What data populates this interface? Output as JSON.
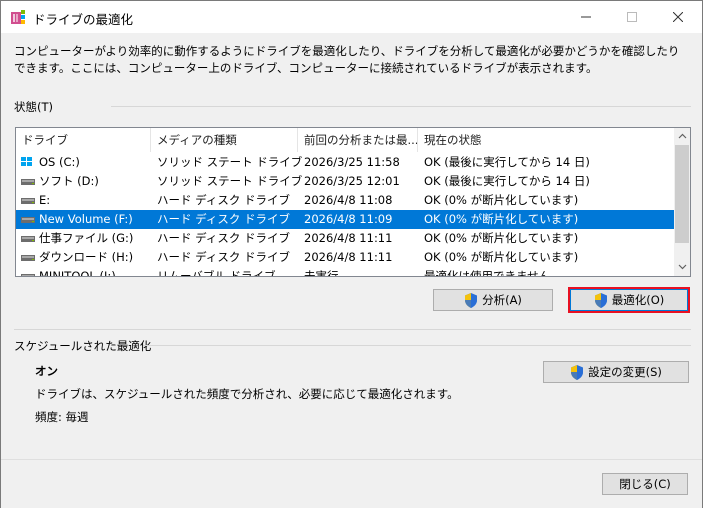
{
  "window": {
    "title": "ドライブの最適化"
  },
  "description": "コンピューターがより効率的に動作するようにドライブを最適化したり、ドライブを分析して最適化が必要かどうかを確認したりできます。ここには、コンピューター上のドライブ、コンピューターに接続されているドライブが表示されます。",
  "status_section": {
    "label": "状態(T)"
  },
  "table": {
    "columns": [
      "ドライブ",
      "メディアの種類",
      "前回の分析または最...",
      "現在の状態"
    ],
    "rows": [
      {
        "drive": "OS (C:)",
        "media": "ソリッド ステート ドライブ",
        "last": "2026/3/25 11:58",
        "status": "OK (最後に実行してから 14 日)",
        "icon": "windows-drive-icon"
      },
      {
        "drive": "ソフト (D:)",
        "media": "ソリッド ステート ドライブ",
        "last": "2026/3/25 12:01",
        "status": "OK (最後に実行してから 14 日)",
        "icon": "drive-icon"
      },
      {
        "drive": "E:",
        "media": "ハード ディスク ドライブ",
        "last": "2026/4/8 11:08",
        "status": "OK (0% が断片化しています)",
        "icon": "drive-icon"
      },
      {
        "drive": "New Volume (F:)",
        "media": "ハード ディスク ドライブ",
        "last": "2026/4/8 11:09",
        "status": "OK (0% が断片化しています)",
        "icon": "drive-icon"
      },
      {
        "drive": "仕事ファイル (G:)",
        "media": "ハード ディスク ドライブ",
        "last": "2026/4/8 11:11",
        "status": "OK (0% が断片化しています)",
        "icon": "drive-icon"
      },
      {
        "drive": "ダウンロード (H:)",
        "media": "ハード ディスク ドライブ",
        "last": "2026/4/8 11:11",
        "status": "OK (0% が断片化しています)",
        "icon": "drive-icon"
      },
      {
        "drive": "MINITOOL (I:)",
        "media": "リムーバブル ドライブ",
        "last": "未実行",
        "status": "最適化は使用できません",
        "icon": "drive-icon"
      }
    ],
    "selected_row": 3
  },
  "buttons": {
    "analyze": "分析(A)",
    "optimize": "最適化(O)",
    "change_settings": "設定の変更(S)",
    "close": "閉じる(C)"
  },
  "schedule": {
    "label": "スケジュールされた最適化",
    "state": "オン",
    "description": "ドライブは、スケジュールされた頻度で分析され、必要に応じて最適化されます。",
    "frequency": "頻度: 毎週"
  },
  "colors": {
    "selection": "#0078d7",
    "highlight_border": "#e81123"
  }
}
